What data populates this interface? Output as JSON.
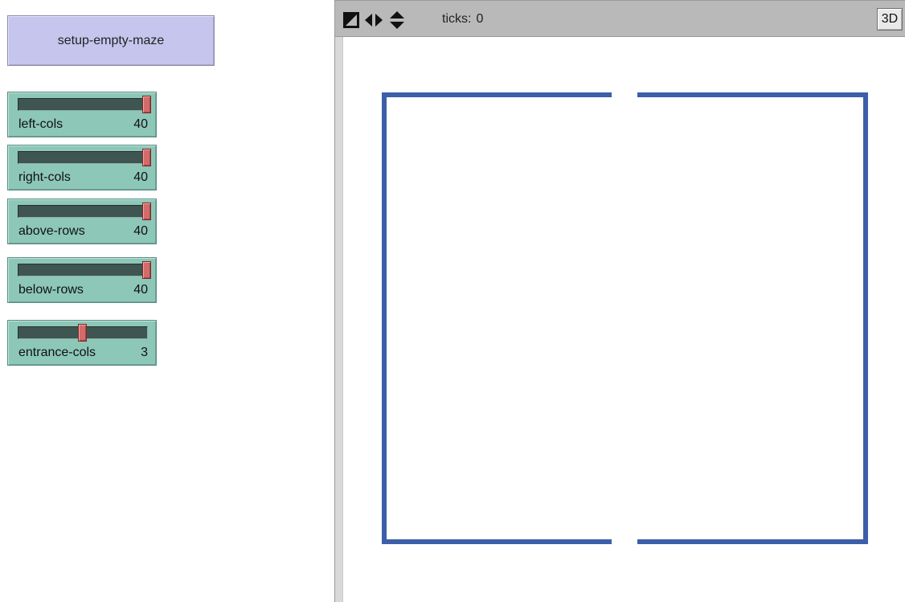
{
  "buttons": {
    "setup_label": "setup-empty-maze"
  },
  "sliders": [
    {
      "label": "left-cols",
      "value": "40",
      "level": 1.0
    },
    {
      "label": "right-cols",
      "value": "40",
      "level": 1.0
    },
    {
      "label": "above-rows",
      "value": "40",
      "level": 1.0
    },
    {
      "label": "below-rows",
      "value": "40",
      "level": 1.0
    },
    {
      "label": "entrance-cols",
      "value": "3",
      "level": 0.5
    }
  ],
  "view": {
    "ticks_label": "ticks:",
    "ticks_value": "0",
    "button_3d_label": "3D",
    "icons": [
      "perspective-icon",
      "horizontal-arrows-icon",
      "vertical-arrows-icon"
    ]
  },
  "colors": {
    "button_bg": "#c6c5ee",
    "slider_bg": "#8dc7b8",
    "slider_track": "#3e5551",
    "slider_thumb": "#d46a6a",
    "maze_wall": "#3b5fa8",
    "toolbar_bg": "#b9b9b9"
  }
}
